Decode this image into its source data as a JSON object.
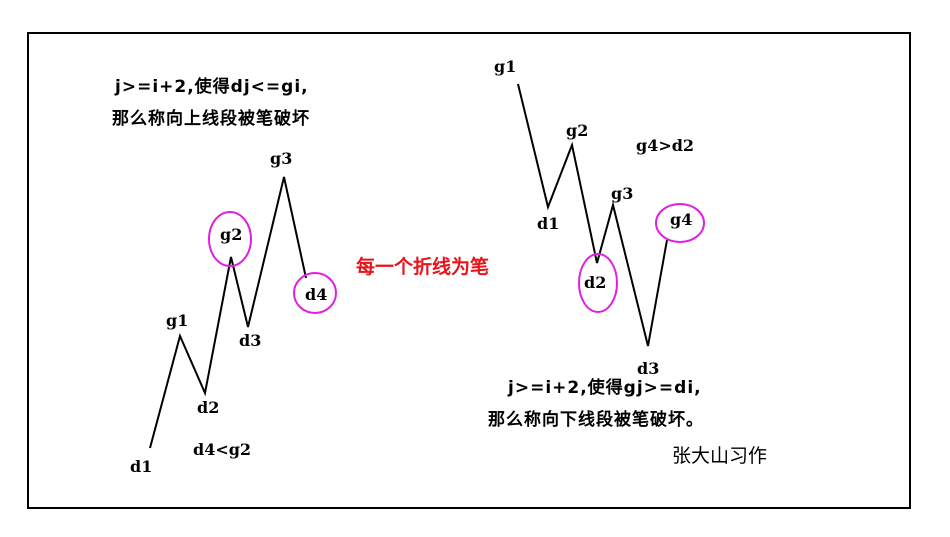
{
  "left": {
    "note_line1": "j>=i+2,使得dj<=gi,",
    "note_line2": "那么称向上线段被笔破坏",
    "points": {
      "d1": "d1",
      "g1": "g1",
      "d2": "d2",
      "g2": "g2",
      "d3": "d3",
      "g3": "g3",
      "d4": "d4"
    },
    "condition": "d4<g2"
  },
  "center_note": "每一个折线为笔",
  "right": {
    "condition": "g4>d2",
    "points": {
      "g1": "g1",
      "d1": "d1",
      "g2": "g2",
      "d2": "d2",
      "g3": "g3",
      "d3": "d3",
      "g4": "g4"
    },
    "note_line1": "j>=i+2,使得gj>=di,",
    "note_line2": "那么称向下线段被笔破坏。"
  },
  "author": "张大山习作",
  "colors": {
    "center_note": "#e8141b",
    "highlight_circle": "#e020e0"
  }
}
